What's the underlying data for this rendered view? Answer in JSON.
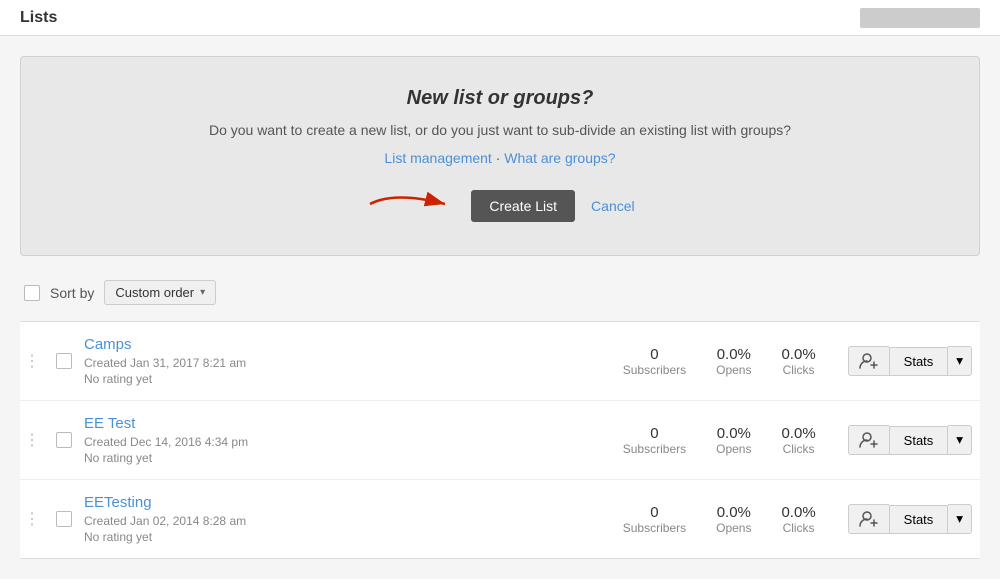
{
  "topbar": {
    "logo": "Lists",
    "right_placeholder": ""
  },
  "banner": {
    "title": "New list or groups?",
    "description": "Do you want to create a new list, or do you just want to sub-divide an existing list with groups?",
    "link1_label": "List management",
    "link1_separator": " · ",
    "link2_label": "What are groups?",
    "create_button_label": "Create List",
    "cancel_label": "Cancel"
  },
  "sort_bar": {
    "label": "Sort by",
    "dropdown_label": "Custom order",
    "dropdown_chevron": "▾"
  },
  "lists": [
    {
      "name": "Camps",
      "created": "Created Jan 31, 2017 8:21 am",
      "rating": "No rating yet",
      "subscribers": 0,
      "opens": "0.0%",
      "clicks": "0.0%"
    },
    {
      "name": "EE Test",
      "created": "Created Dec 14, 2016 4:34 pm",
      "rating": "No rating yet",
      "subscribers": 0,
      "opens": "0.0%",
      "clicks": "0.0%"
    },
    {
      "name": "EETesting",
      "created": "Created Jan 02, 2014 8:28 am",
      "rating": "No rating yet",
      "subscribers": 0,
      "opens": "0.0%",
      "clicks": "0.0%"
    }
  ],
  "stats_labels": {
    "subscribers": "Subscribers",
    "opens": "Opens",
    "clicks": "Clicks"
  },
  "actions": {
    "stats_label": "Stats",
    "dropdown_chevron": "▾"
  }
}
